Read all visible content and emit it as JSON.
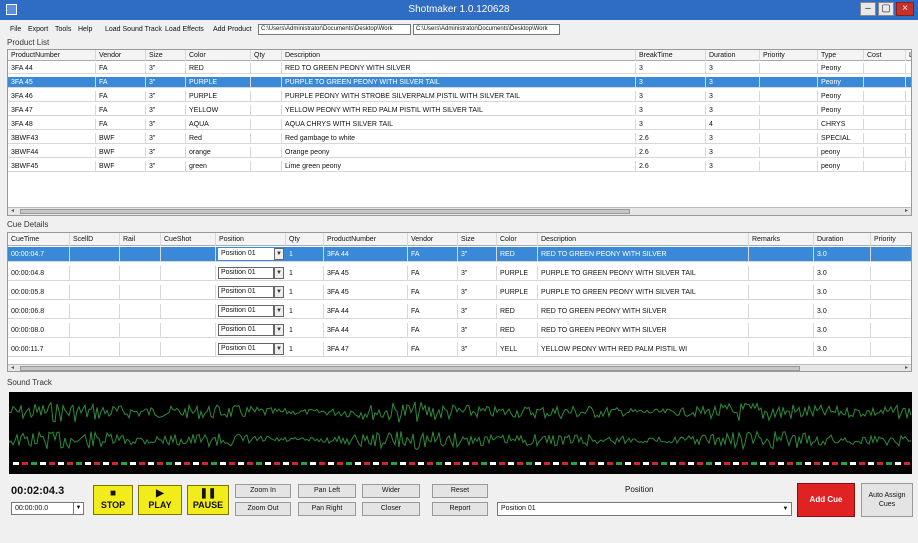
{
  "window": {
    "title": "Shotmaker 1.0.120628",
    "minimize": "–",
    "maximize": "▢",
    "close": "×"
  },
  "menu": {
    "items": [
      "File",
      "Export",
      "Tools",
      "Help",
      "Load Sound Track",
      "Load Effects",
      "Add Product"
    ],
    "paths": [
      "C:\\Users\\Administrator\\Documents\\Desktop\\Work",
      "C:\\Users\\Administrator\\Documents\\Desktop\\Work"
    ]
  },
  "product_list": {
    "label": "Product List",
    "headers": [
      "ProductNumber",
      "Vendor",
      "Size",
      "Color",
      "Qty",
      "Description",
      "BreakTime",
      "Duration",
      "Priority",
      "Type",
      "Cost",
      "Loc"
    ],
    "rows": [
      [
        "3FA 44",
        "FA",
        "3\"",
        "RED",
        "",
        "RED TO GREEN PEONY WITH SILVER",
        "3",
        "3",
        "",
        "Peony",
        "",
        ""
      ],
      [
        "3FA 45",
        "FA",
        "3\"",
        "PURPLE",
        "",
        "PURPLE TO GREEN PEONY WITH SILVER TAIL",
        "3",
        "3",
        "",
        "Peony",
        "",
        ""
      ],
      [
        "3FA 46",
        "FA",
        "3\"",
        "PURPLE",
        "",
        "PURPLE PEONY WITH STROBE SILVERPALM PISTIL WITH SILVER TAIL",
        "3",
        "3",
        "",
        "Peony",
        "",
        ""
      ],
      [
        "3FA 47",
        "FA",
        "3\"",
        "YELLOW",
        "",
        "YELLOW PEONY WITH RED PALM PISTIL WITH SILVER TAIL",
        "3",
        "3",
        "",
        "Peony",
        "",
        ""
      ],
      [
        "3FA 48",
        "FA",
        "3\"",
        "AQUA",
        "",
        "AQUA CHRYS WITH SILVER TAIL",
        "3",
        "4",
        "",
        "CHRYS",
        "",
        ""
      ],
      [
        "3BWF43",
        "BWF",
        "3\"",
        "Red",
        "",
        "Red gambage to white",
        "2.6",
        "3",
        "",
        "SPECIAL",
        "",
        ""
      ],
      [
        "3BWF44",
        "BWF",
        "3\"",
        "orange",
        "",
        "Orange peony",
        "2.6",
        "3",
        "",
        "peony",
        "",
        ""
      ],
      [
        "3BWF45",
        "BWF",
        "3\"",
        "green",
        "",
        "Lime green peony",
        "2.6",
        "3",
        "",
        "peony",
        "",
        ""
      ]
    ],
    "selected_index": 1
  },
  "cue_details": {
    "label": "Cue Details",
    "headers": [
      "CueTime",
      "ScellD",
      "Rail",
      "CueShot",
      "Position",
      "Qty",
      "ProductNumber",
      "Vendor",
      "Size",
      "Color",
      "Description",
      "Remarks",
      "Duration",
      "Priority"
    ],
    "rows": [
      [
        "00:00:04.7",
        "",
        "",
        "",
        "Position 01",
        "1",
        "3FA 44",
        "FA",
        "3\"",
        "RED",
        "RED TO GREEN PEONY WITH SILVER",
        "",
        "3.0",
        ""
      ],
      [
        "00:00:04.8",
        "",
        "",
        "",
        "Position 01",
        "1",
        "3FA 45",
        "FA",
        "3\"",
        "PURPLE",
        "PURPLE TO GREEN PEONY WITH SILVER TAIL",
        "",
        "3.0",
        ""
      ],
      [
        "00:00:05.8",
        "",
        "",
        "",
        "Position 01",
        "1",
        "3FA 45",
        "FA",
        "3\"",
        "PURPLE",
        "PURPLE TO GREEN PEONY WITH SILVER TAIL",
        "",
        "3.0",
        ""
      ],
      [
        "00:00:06.8",
        "",
        "",
        "",
        "Position 01",
        "1",
        "3FA 44",
        "FA",
        "3\"",
        "RED",
        "RED TO GREEN PEONY WITH SILVER",
        "",
        "3.0",
        ""
      ],
      [
        "00:00:08.0",
        "",
        "",
        "",
        "Position 01",
        "1",
        "3FA 44",
        "FA",
        "3\"",
        "RED",
        "RED TO GREEN PEONY WITH SILVER",
        "",
        "3.0",
        ""
      ],
      [
        "00:00:11.7",
        "",
        "",
        "",
        "Position 01",
        "1",
        "3FA 47",
        "FA",
        "3\"",
        "YELL",
        "YELLOW PEONY WITH RED PALM PISTIL WI",
        "",
        "3.0",
        ""
      ]
    ],
    "selected_index": 0
  },
  "sound_track": {
    "label": "Sound Track"
  },
  "controls": {
    "time_display": "00:02:04.3",
    "time_select": "00:00:00.0",
    "stop": "STOP",
    "stop_glyph": "■",
    "play": "PLAY",
    "play_glyph": "▶",
    "pause": "PAUSE",
    "pause_glyph": "❚❚",
    "zoom_in": "Zoom In",
    "zoom_out": "Zoom Out",
    "pan_left": "Pan Left",
    "pan_right": "Pan Right",
    "wider": "Wider",
    "closer": "Closer",
    "reset": "Reset",
    "report": "Report",
    "position_label": "Position",
    "position_value": "Position 01",
    "add_cue": "Add Cue",
    "auto_assign_line1": "Auto Assign",
    "auto_assign_line2": "Cues"
  },
  "colors": {
    "selection": "#3a88d8",
    "transport": "#f3ec1b",
    "add_cue": "#e02222",
    "waveform": "#2e8b3a"
  }
}
